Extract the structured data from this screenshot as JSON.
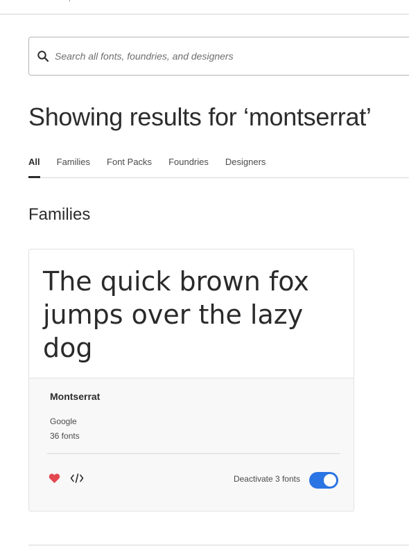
{
  "search": {
    "placeholder": "Search all fonts, foundries, and designers",
    "icon": "search-icon"
  },
  "results_title": "Showing results for ‘montserrat’",
  "tabs": [
    {
      "label": "All",
      "active": true
    },
    {
      "label": "Families",
      "active": false
    },
    {
      "label": "Font Packs",
      "active": false
    },
    {
      "label": "Foundries",
      "active": false
    },
    {
      "label": "Designers",
      "active": false
    }
  ],
  "families_section": {
    "heading": "Families",
    "cards": [
      {
        "sample_text": "The quick brown fox jumps over the lazy dog",
        "name": "Montserrat",
        "foundry": "Google",
        "font_count": "36 fonts",
        "activation_label": "Deactivate 3 fonts",
        "activated": true,
        "favorite": true
      }
    ]
  },
  "colors": {
    "accent": "#2b74e3",
    "favorite": "#e34850",
    "text": "#2c2c2c"
  }
}
